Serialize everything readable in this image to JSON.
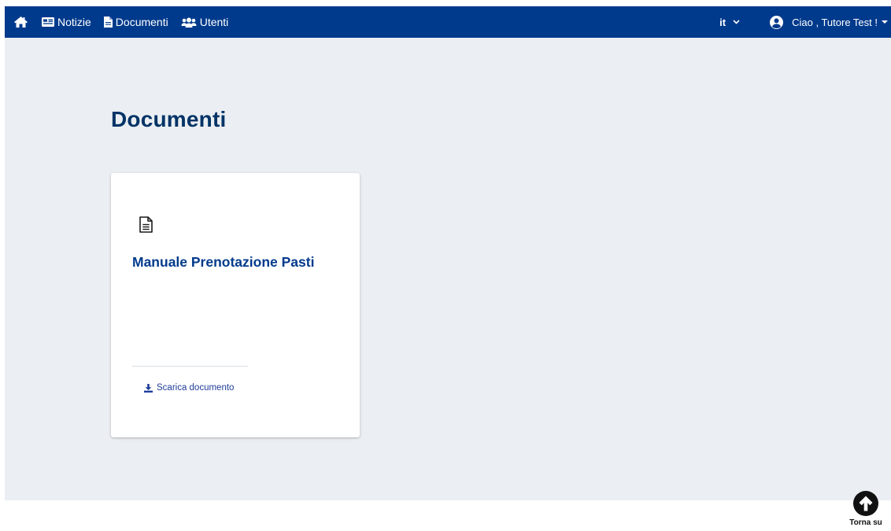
{
  "navbar": {
    "background": "#003a8c",
    "home_icon": "home-icon",
    "items": [
      {
        "label": "Notizie",
        "icon": "newspaper-icon"
      },
      {
        "label": "Documenti",
        "icon": "file-icon"
      },
      {
        "label": "Utenti",
        "icon": "users-icon"
      }
    ],
    "language": {
      "value": "it",
      "icon": "chevron-down-icon"
    },
    "user": {
      "greeting": "Ciao , Tutore Test !",
      "icon": "user-circle-icon"
    }
  },
  "page": {
    "title": "Documenti",
    "background": "#ebeef2"
  },
  "documents": [
    {
      "title": "Manuale Prenotazione Pasti",
      "icon": "document-icon",
      "download_label": "Scarica documento",
      "download_icon": "download-icon"
    }
  ],
  "back_to_top": {
    "label": "Torna su",
    "icon": "arrow-up-circle-icon"
  }
}
